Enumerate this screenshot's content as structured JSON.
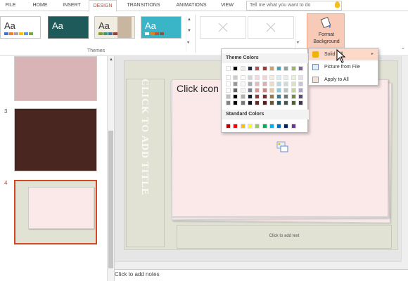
{
  "tabs": [
    {
      "label": "FILE"
    },
    {
      "label": "HOME"
    },
    {
      "label": "INSERT"
    },
    {
      "label": "DESIGN",
      "active": true
    },
    {
      "label": "TRANSITIONS"
    },
    {
      "label": "ANIMATIONS"
    },
    {
      "label": "VIEW"
    }
  ],
  "tellme": {
    "placeholder": "Tell me what you want to do"
  },
  "ribbon": {
    "themes": [
      {
        "label": "Aa",
        "bg": "#ffffff",
        "fg": "#333333"
      },
      {
        "label": "Aa",
        "bg": "#1e5a5a",
        "fg": "#ffffff"
      },
      {
        "label": "Aa",
        "bg": "#f0ece0",
        "fg": "#333333"
      },
      {
        "label": "Aa",
        "bg": "#3ab5c8",
        "fg": "#ffffff"
      }
    ],
    "themes_group_label": "Themes",
    "format_background": {
      "line1": "Format",
      "line2": "Background"
    }
  },
  "slides": [
    {
      "number": "",
      "bg": "#d8b4b6"
    },
    {
      "number": "3",
      "bg": "#4a2620"
    },
    {
      "number": "4",
      "bg": "#e1e2d4",
      "selected": true
    }
  ],
  "slide": {
    "title_placeholder": "CLICK TO ADD TITLE",
    "content_title": "Click icon",
    "text_placeholder": "Click to add text"
  },
  "notes": {
    "placeholder": "Click to add notes"
  },
  "palette": {
    "theme_colors_label": "Theme Colors",
    "standard_colors_label": "Standard Colors",
    "theme_top": [
      "#ffffff",
      "#000000",
      "#eeece1",
      "#1f2a44",
      "#c0504d",
      "#9b3b3a",
      "#c9a56b",
      "#4aa3b5",
      "#8fa39b",
      "#9bbb59",
      "#8064a2"
    ],
    "standard": [
      "#c00000",
      "#ff0000",
      "#ffc000",
      "#ffff00",
      "#92d050",
      "#00b050",
      "#00b0f0",
      "#0070c0",
      "#002060",
      "#7030a0"
    ]
  },
  "fill_menu": {
    "items": [
      {
        "label": "Solid Fill",
        "highlighted": true,
        "submenu": true
      },
      {
        "label": "Picture from File"
      },
      {
        "label": "Apply to All"
      }
    ]
  }
}
